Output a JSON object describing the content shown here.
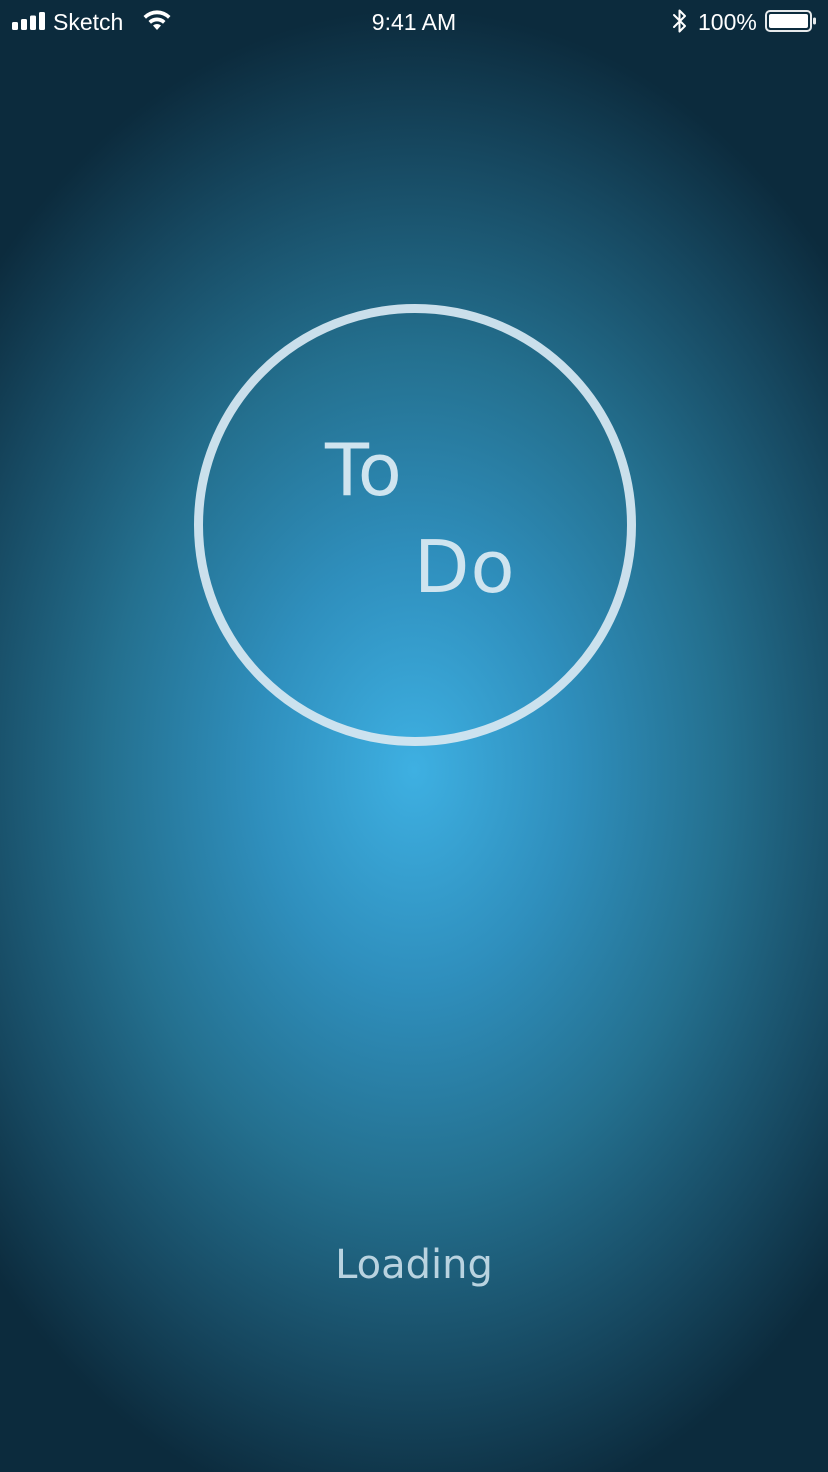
{
  "status_bar": {
    "carrier": "Sketch",
    "time": "9:41 AM",
    "battery_percent": "100%",
    "signal_bars": 4,
    "battery_level": 1.0,
    "icons": [
      "signal-icon",
      "wifi-icon",
      "bluetooth-icon",
      "battery-icon"
    ]
  },
  "splash": {
    "logo_line1": "To",
    "logo_line2": "Do",
    "loading_label": "Loading"
  },
  "colors": {
    "background_center": "#3eb0e2",
    "background_edge": "#0c2b3d",
    "ring": "#d4e6f0",
    "logo_text": "#cfe4ef",
    "loading_text": "#b9d3e0"
  }
}
